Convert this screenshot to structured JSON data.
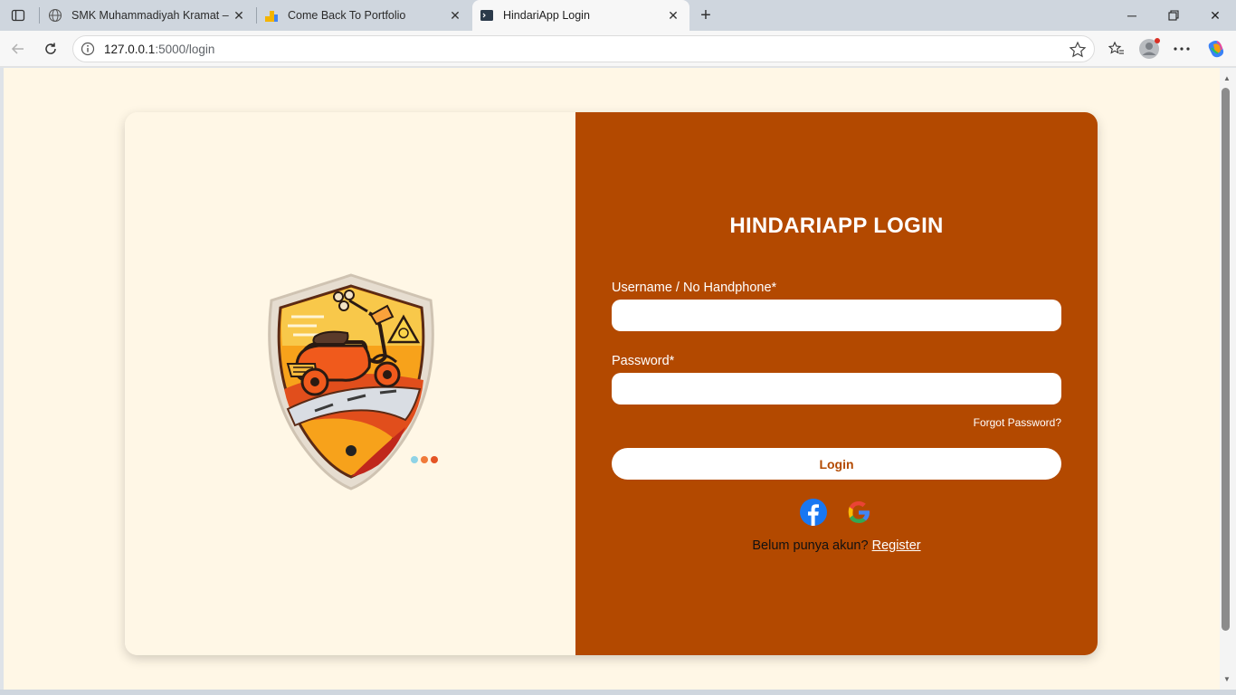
{
  "browser": {
    "tabs": [
      {
        "title": "SMK Muhammadiyah Kramat – Sc",
        "active": false
      },
      {
        "title": "Come Back To Portfolio",
        "active": false
      },
      {
        "title": "HindariApp Login",
        "active": true
      }
    ],
    "url_host": "127.0.0.1",
    "url_path": ":5000/login"
  },
  "login": {
    "title": "HINDARIAPP LOGIN",
    "username_label": "Username / No Handphone*",
    "username_value": "",
    "password_label": "Password*",
    "password_value": "",
    "forgot_label": "Forgot Password?",
    "login_button": "Login",
    "register_prompt": "Belum punya akun?",
    "register_link": "Register"
  },
  "colors": {
    "panel_accent": "#b34900",
    "page_background": "#fff7e6"
  }
}
